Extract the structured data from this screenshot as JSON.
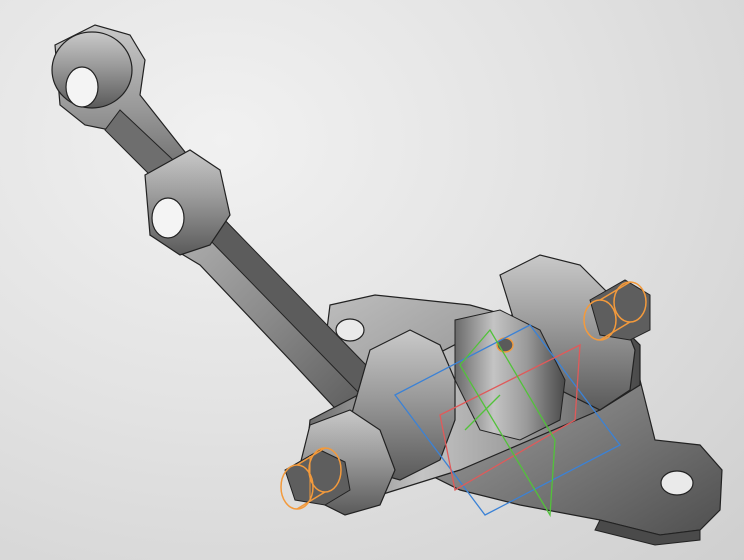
{
  "viewport": {
    "background_top": "#f1f1f1",
    "background_bottom": "#cfcfcf"
  },
  "colors": {
    "part_light": "#b9b9b9",
    "part_mid": "#8e8e8e",
    "part_dark": "#4e4e4e",
    "edges": "#222222",
    "thread_highlight": "#f39a3c",
    "plane_xy": "#e05a5a",
    "plane_yz": "#3b82d6",
    "plane_zx": "#52c23a"
  },
  "scene": {
    "objects": [
      "upper-link-arm",
      "lower-link-arm",
      "pivot-bracket-plate",
      "bearing-housing",
      "left-threaded-bolt",
      "right-threaded-bolt",
      "origin-planes"
    ]
  }
}
